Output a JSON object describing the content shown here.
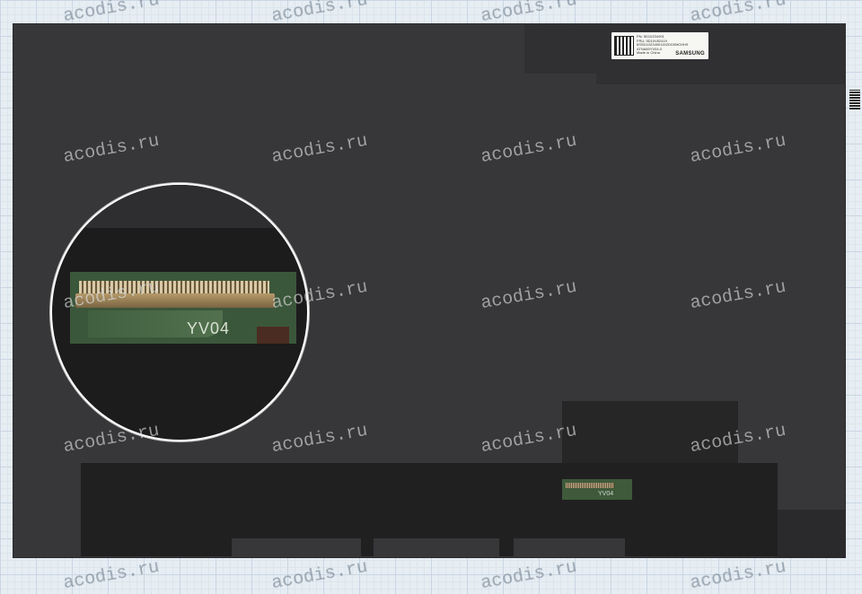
{
  "watermark_text": "acodis.ru",
  "connector_label": "YV04",
  "sticker": {
    "lines": [
      "PN: 5D10Z34901",
      "FRU: 5D10V82419",
      "8SSD10Z34901152DG0MCHH9",
      "ATNA60YV04-0",
      "Made in China"
    ],
    "brand": "SAMSUNG"
  }
}
